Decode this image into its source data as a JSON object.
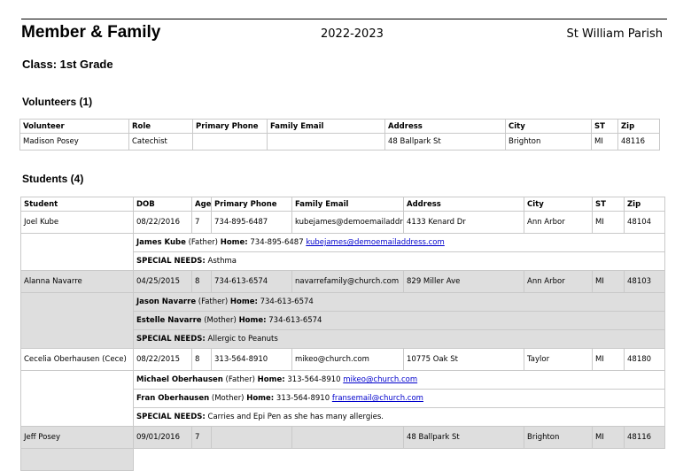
{
  "header": {
    "title": "Member & Family",
    "year": "2022-2023",
    "parish": "St William Parish",
    "class_label": "Class: 1st Grade"
  },
  "volunteers": {
    "heading": "Volunteers (1)",
    "columns": [
      "Volunteer",
      "Role",
      "Primary Phone",
      "Family Email",
      "Address",
      "City",
      "ST",
      "Zip"
    ],
    "rows": [
      {
        "name": "Madison Posey",
        "role": "Catechist",
        "phone": "",
        "email": "",
        "address": "48 Ballpark St",
        "city": "Brighton",
        "st": "MI",
        "zip": "48116"
      }
    ]
  },
  "students": {
    "heading": "Students (4)",
    "columns": [
      "Student",
      "DOB",
      "Age",
      "Primary Phone",
      "Family Email",
      "Address",
      "City",
      "ST",
      "Zip"
    ],
    "special_label": "SPECIAL NEEDS:",
    "home_label": "Home:",
    "rows": [
      {
        "name": "Joel Kube",
        "dob": "08/22/2016",
        "age": "7",
        "phone": "734-895-6487",
        "email": "kubejames@demoemailaddress.com",
        "address": "4133 Kenard Dr",
        "city": "Ann Arbor",
        "st": "MI",
        "zip": "48104",
        "parents": [
          {
            "name": "James Kube",
            "rel": "(Father)",
            "home": "734-895-6487",
            "email": "kubejames@demoemailaddress.com"
          }
        ],
        "special": "Asthma"
      },
      {
        "name": "Alanna Navarre",
        "dob": "04/25/2015",
        "age": "8",
        "phone": "734-613-6574",
        "email": "navarrefamily@church.com",
        "address": "829 Miller Ave",
        "city": "Ann Arbor",
        "st": "MI",
        "zip": "48103",
        "parents": [
          {
            "name": "Jason Navarre",
            "rel": "(Father)",
            "home": "734-613-6574",
            "email": ""
          },
          {
            "name": "Estelle Navarre",
            "rel": "(Mother)",
            "home": "734-613-6574",
            "email": ""
          }
        ],
        "special": "Allergic to Peanuts"
      },
      {
        "name": "Cecelia Oberhausen (Cece)",
        "dob": "08/22/2015",
        "age": "8",
        "phone": "313-564-8910",
        "email": "mikeo@church.com",
        "address": "10775 Oak St",
        "city": "Taylor",
        "st": "MI",
        "zip": "48180",
        "parents": [
          {
            "name": "Michael Oberhausen",
            "rel": "(Father)",
            "home": "313-564-8910",
            "email": "mikeo@church.com"
          },
          {
            "name": "Fran Oberhausen",
            "rel": "(Mother)",
            "home": "313-564-8910",
            "email": "fransemail@church.com"
          }
        ],
        "special": "Carries and Epi Pen as she has many allergies."
      },
      {
        "name": "Jeff Posey",
        "dob": "09/01/2016",
        "age": "7",
        "phone": "",
        "email": "",
        "address": "48 Ballpark St",
        "city": "Brighton",
        "st": "MI",
        "zip": "48116",
        "parents": [],
        "special": ""
      }
    ]
  }
}
